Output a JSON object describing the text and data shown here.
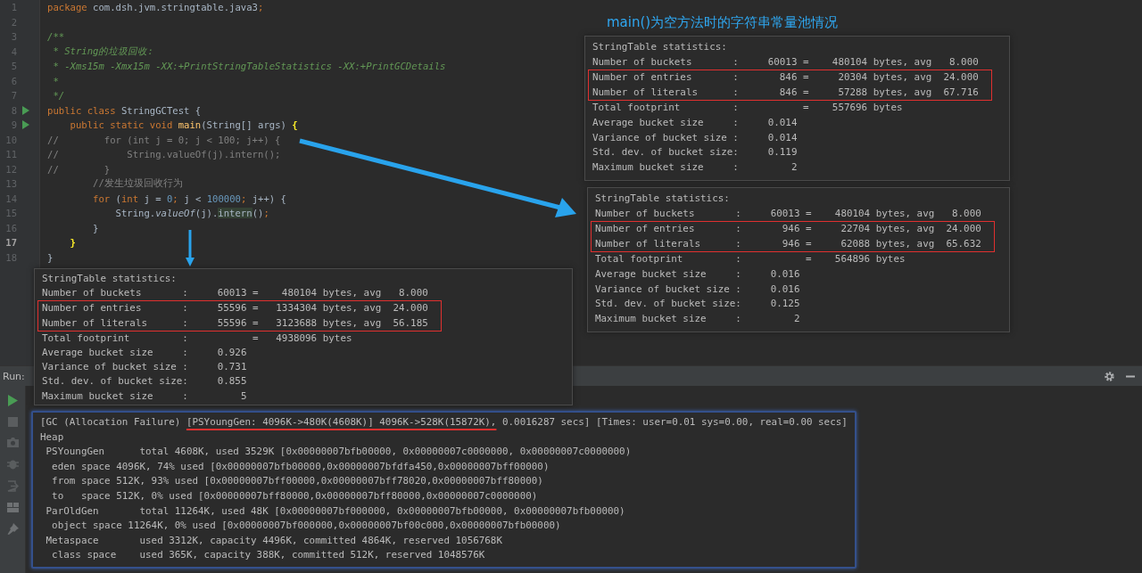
{
  "editor": {
    "lines": [
      {
        "number": "1",
        "current": false,
        "tokens": [
          {
            "kind": "keyword",
            "text": "package"
          },
          {
            "kind": "plain",
            "text": " com.dsh.jvm.stringtable.java3"
          },
          {
            "kind": "keyword",
            "text": ";"
          }
        ]
      },
      {
        "number": "2",
        "current": false
      },
      {
        "number": "3",
        "current": false,
        "tokens": [
          {
            "kind": "doc",
            "text": "/**"
          }
        ]
      },
      {
        "number": "4",
        "current": false,
        "tokens": [
          {
            "kind": "doc",
            "text": " * String的垃圾回收:"
          }
        ]
      },
      {
        "number": "5",
        "current": false,
        "tokens": [
          {
            "kind": "doc",
            "text": " * -Xms15m -Xmx15m -XX:+PrintStringTableStatistics -XX:+PrintGCDetails"
          }
        ]
      },
      {
        "number": "6",
        "current": false,
        "tokens": [
          {
            "kind": "doc",
            "text": " *"
          }
        ]
      },
      {
        "number": "7",
        "current": false,
        "tokens": [
          {
            "kind": "doc",
            "text": " */"
          }
        ]
      },
      {
        "number": "8",
        "run_marker": true,
        "current": false,
        "tokens": [
          {
            "kind": "keyword",
            "text": "public class "
          },
          {
            "kind": "plain",
            "text": "StringGCTest {"
          }
        ]
      },
      {
        "number": "9",
        "run_marker": true,
        "current": false,
        "tokens": [
          {
            "kind": "keyword",
            "text": "    public static void "
          },
          {
            "kind": "method",
            "text": "main"
          },
          {
            "kind": "plain",
            "text": "(String[] args) "
          },
          {
            "kind": "brace",
            "text": "{"
          }
        ]
      },
      {
        "number": "10",
        "current": false,
        "tokens": [
          {
            "kind": "comment",
            "text": "//        for (int j = 0; j < 100; j++) {"
          }
        ]
      },
      {
        "number": "11",
        "current": false,
        "tokens": [
          {
            "kind": "comment",
            "text": "//            String.valueOf(j).intern();"
          }
        ]
      },
      {
        "number": "12",
        "current": false,
        "tokens": [
          {
            "kind": "comment",
            "text": "//        }"
          }
        ]
      },
      {
        "number": "13",
        "current": false,
        "tokens": [
          {
            "kind": "comment",
            "text": "        //发生垃圾回收行为"
          }
        ]
      },
      {
        "number": "14",
        "current": false,
        "tokens": [
          {
            "kind": "keyword",
            "text": "        for "
          },
          {
            "kind": "plain",
            "text": "("
          },
          {
            "kind": "keyword",
            "text": "int "
          },
          {
            "kind": "plain",
            "text": "j = "
          },
          {
            "kind": "number",
            "text": "0"
          },
          {
            "kind": "keyword",
            "text": "; "
          },
          {
            "kind": "plain",
            "text": "j < "
          },
          {
            "kind": "number",
            "text": "100000"
          },
          {
            "kind": "keyword",
            "text": "; "
          },
          {
            "kind": "plain",
            "text": "j++) {"
          }
        ]
      },
      {
        "number": "15",
        "current": false,
        "tokens": [
          {
            "kind": "plain",
            "text": "            String."
          },
          {
            "kind": "static",
            "text": "valueOf"
          },
          {
            "kind": "plain",
            "text": "(j)."
          },
          {
            "kind": "usage",
            "text": "intern"
          },
          {
            "kind": "plain",
            "text": "()"
          },
          {
            "kind": "keyword",
            "text": ";"
          }
        ]
      },
      {
        "number": "16",
        "current": false,
        "tokens": [
          {
            "kind": "plain",
            "text": "        }"
          }
        ]
      },
      {
        "number": "17",
        "current": true,
        "tokens": [
          {
            "kind": "brace",
            "text": "    }"
          }
        ]
      },
      {
        "number": "18",
        "current": false,
        "tokens": [
          {
            "kind": "plain",
            "text": "}"
          }
        ]
      }
    ]
  },
  "run_bar": {
    "label": "Run:"
  },
  "console": {
    "lines": [
      {
        "segments": [
          {
            "text": "[GC (Allocation Failure) "
          },
          {
            "text": "[PSYoungGen: 4096K->480K(4608K)] 4096K->528K(15872K),",
            "underlined": true
          },
          {
            "text": " 0.0016287 secs] [Times: user=0.01 sys=0.00, real=0.00 secs]"
          }
        ]
      },
      {
        "segments": [
          {
            "text": "Heap"
          }
        ]
      },
      {
        "segments": [
          {
            "text": " PSYoungGen      total 4608K, used 3529K [0x00000007bfb00000, 0x00000007c0000000, 0x00000007c0000000)"
          }
        ]
      },
      {
        "segments": [
          {
            "text": "  eden space 4096K, 74% used [0x00000007bfb00000,0x00000007bfdfa450,0x00000007bff00000)"
          }
        ]
      },
      {
        "segments": [
          {
            "text": "  from space 512K, 93% used [0x00000007bff00000,0x00000007bff78020,0x00000007bff80000)"
          }
        ]
      },
      {
        "segments": [
          {
            "text": "  to   space 512K, 0% used [0x00000007bff80000,0x00000007bff80000,0x00000007c0000000)"
          }
        ]
      },
      {
        "segments": [
          {
            "text": " ParOldGen       total 11264K, used 48K [0x00000007bf000000, 0x00000007bfb00000, 0x00000007bfb00000)"
          }
        ]
      },
      {
        "segments": [
          {
            "text": "  object space 11264K, 0% used [0x00000007bf000000,0x00000007bf00c000,0x00000007bfb00000)"
          }
        ]
      },
      {
        "segments": [
          {
            "text": " Metaspace       used 3312K, capacity 4496K, committed 4864K, reserved 1056768K"
          }
        ]
      },
      {
        "segments": [
          {
            "text": "  class space    used 365K, capacity 388K, committed 512K, reserved 1048576K"
          }
        ]
      }
    ]
  },
  "annotation_heading": "main()为空方法时的字符串常量池情况",
  "stats_panels": [
    {
      "rows": [
        {
          "text": "StringTable statistics:",
          "highlighted": false
        },
        {
          "text": "Number of buckets       :     60013 =    480104 bytes, avg   8.000",
          "highlighted": false
        },
        {
          "text": "Number of entries       :     55596 =   1334304 bytes, avg  24.000",
          "highlighted": true
        },
        {
          "text": "Number of literals      :     55596 =   3123688 bytes, avg  56.185",
          "highlighted": true
        },
        {
          "text": "Total footprint         :           =   4938096 bytes",
          "highlighted": false
        },
        {
          "text": "Average bucket size     :     0.926",
          "highlighted": false
        },
        {
          "text": "Variance of bucket size :     0.731",
          "highlighted": false
        },
        {
          "text": "Std. dev. of bucket size:     0.855",
          "highlighted": false
        },
        {
          "text": "Maximum bucket size     :         5",
          "highlighted": false
        }
      ]
    },
    {
      "rows": [
        {
          "text": "StringTable statistics:",
          "highlighted": false
        },
        {
          "text": "Number of buckets       :     60013 =    480104 bytes, avg   8.000",
          "highlighted": false
        },
        {
          "text": "Number of entries       :       846 =     20304 bytes, avg  24.000",
          "highlighted": true
        },
        {
          "text": "Number of literals      :       846 =     57288 bytes, avg  67.716",
          "highlighted": true
        },
        {
          "text": "Total footprint         :           =    557696 bytes",
          "highlighted": false
        },
        {
          "text": "Average bucket size     :     0.014",
          "highlighted": false
        },
        {
          "text": "Variance of bucket size :     0.014",
          "highlighted": false
        },
        {
          "text": "Std. dev. of bucket size:     0.119",
          "highlighted": false
        },
        {
          "text": "Maximum bucket size     :         2",
          "highlighted": false
        }
      ]
    },
    {
      "rows": [
        {
          "text": "StringTable statistics:",
          "highlighted": false
        },
        {
          "text": "Number of buckets       :     60013 =    480104 bytes, avg   8.000",
          "highlighted": false
        },
        {
          "text": "Number of entries       :       946 =     22704 bytes, avg  24.000",
          "highlighted": true
        },
        {
          "text": "Number of literals      :       946 =     62088 bytes, avg  65.632",
          "highlighted": true
        },
        {
          "text": "Total footprint         :           =    564896 bytes",
          "highlighted": false
        },
        {
          "text": "Average bucket size     :     0.016",
          "highlighted": false
        },
        {
          "text": "Variance of bucket size :     0.016",
          "highlighted": false
        },
        {
          "text": "Std. dev. of bucket size:     0.125",
          "highlighted": false
        },
        {
          "text": "Maximum bucket size     :         2",
          "highlighted": false
        }
      ]
    }
  ]
}
